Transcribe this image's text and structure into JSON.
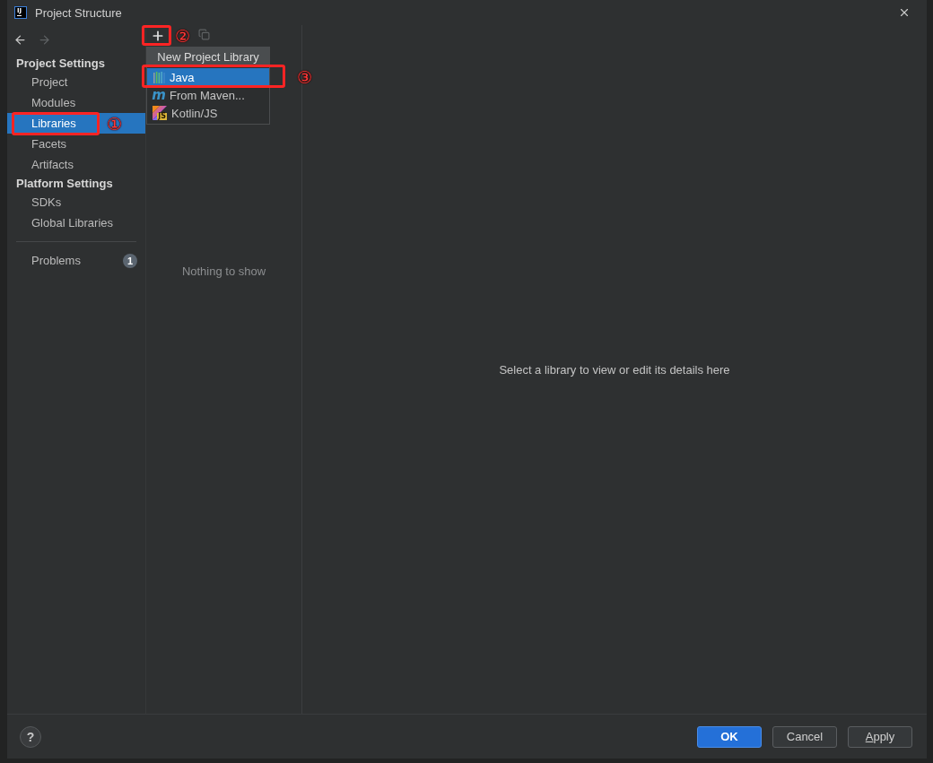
{
  "window": {
    "logo": "IJ",
    "title": "Project Structure"
  },
  "navigation": {
    "back": {
      "disabled": false
    },
    "forward": {
      "disabled": true
    }
  },
  "sidebar": {
    "sections": [
      {
        "title": "Project Settings",
        "items": [
          {
            "label": "Project",
            "selected": false
          },
          {
            "label": "Modules",
            "selected": false
          },
          {
            "label": "Libraries",
            "selected": true,
            "annotation": "①"
          },
          {
            "label": "Facets",
            "selected": false
          },
          {
            "label": "Artifacts",
            "selected": false
          }
        ]
      },
      {
        "title": "Platform Settings",
        "items": [
          {
            "label": "SDKs",
            "selected": false
          },
          {
            "label": "Global Libraries",
            "selected": false
          }
        ]
      }
    ],
    "problems": {
      "label": "Problems",
      "count": "1"
    }
  },
  "libraries": {
    "toolbar": [
      {
        "kind": "add",
        "disabled": false,
        "annotation": "②"
      },
      {
        "kind": "copy",
        "disabled": true
      }
    ],
    "empty_text": "Nothing to show",
    "menu": {
      "title": "New Project Library",
      "items": [
        {
          "kind": "java",
          "label": "Java",
          "selected": true,
          "annotation": "③"
        },
        {
          "kind": "maven",
          "icon_text": "m",
          "label": "From Maven...",
          "selected": false
        },
        {
          "kind": "kotlin-js",
          "icon_text": "JS",
          "label": "Kotlin/JS",
          "selected": false
        }
      ]
    }
  },
  "details": {
    "empty_text": "Select a library to view or edit its details here"
  },
  "footer": {
    "help": "?",
    "buttons": [
      {
        "kind": "primary",
        "label": "OK"
      },
      {
        "kind": "secondary",
        "label": "Cancel"
      },
      {
        "kind": "secondary",
        "label": "Apply",
        "mnemonic": true
      }
    ]
  }
}
